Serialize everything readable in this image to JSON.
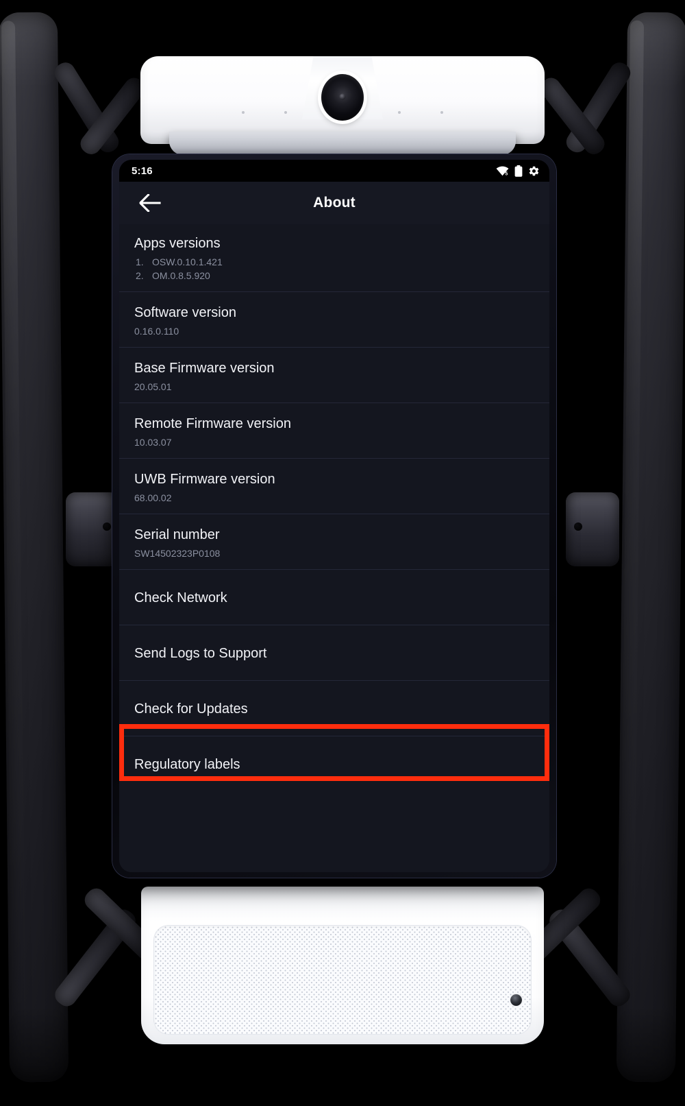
{
  "statusbar": {
    "time": "5:16",
    "icons": [
      "wifi-icon",
      "battery-icon",
      "gear-icon"
    ]
  },
  "appbar": {
    "title": "About",
    "back_label": "Back"
  },
  "colors": {
    "screen_background": "#14161f",
    "appbar_background": "#161822",
    "divider": "#242738",
    "primary_text": "#f2f3f7",
    "secondary_text": "#8b90a0",
    "highlight": "#ff2d0d"
  },
  "list": {
    "rows": [
      {
        "id": "apps-versions",
        "title": "Apps versions",
        "type": "numbered",
        "items": [
          "OSW.0.10.1.421",
          "OM.0.8.5.920"
        ],
        "highlighted": false
      },
      {
        "id": "software-version",
        "title": "Software version",
        "type": "value",
        "value": "0.16.0.110",
        "highlighted": false
      },
      {
        "id": "base-firmware-version",
        "title": "Base Firmware version",
        "type": "value",
        "value": "20.05.01",
        "highlighted": false
      },
      {
        "id": "remote-firmware-version",
        "title": "Remote Firmware version",
        "type": "value",
        "value": "10.03.07",
        "highlighted": false
      },
      {
        "id": "uwb-firmware-version",
        "title": "UWB Firmware version",
        "type": "value",
        "value": "68.00.02",
        "highlighted": false
      },
      {
        "id": "serial-number",
        "title": "Serial number",
        "type": "value",
        "value": "SW14502323P0108",
        "highlighted": false
      },
      {
        "id": "check-network",
        "title": "Check Network",
        "type": "action",
        "highlighted": false
      },
      {
        "id": "send-logs-to-support",
        "title": "Send Logs to Support",
        "type": "action",
        "highlighted": false
      },
      {
        "id": "check-for-updates",
        "title": "Check for Updates",
        "type": "action",
        "highlighted": false
      },
      {
        "id": "regulatory-labels",
        "title": "Regulatory labels",
        "type": "action",
        "highlighted": true
      }
    ]
  },
  "device": {
    "camera_module": "camera-module",
    "camera_lens": "camera-lens-icon",
    "speaker_module": "speaker-module",
    "speaker_port": "speaker-port-icon"
  }
}
